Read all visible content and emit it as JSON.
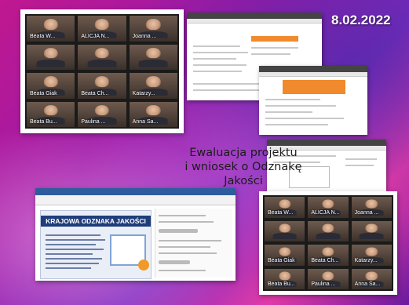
{
  "date": "8.02.2022",
  "title_line1": "Ewaluacja projektu",
  "title_line2": "i wniosek o Odznakę Jakości",
  "slide_banner": "KRAJOWA ODZNAKA JAKOŚCI",
  "meeting1": {
    "participants": [
      "Beata W...",
      "ALICJA N...",
      "Joanna ...",
      "",
      "",
      "",
      "Beata Giak",
      "Beata Ch...",
      "Katarzy...",
      "Beata Bu...",
      "Paulina ...",
      "Anna Sa..."
    ]
  },
  "meeting2": {
    "participants": [
      "Beata W...",
      "ALICJA N...",
      "Joanna ...",
      "",
      "",
      "",
      "Beata Giak",
      "Beata Ch...",
      "Katarzy...",
      "Beata Bu...",
      "Paulina ...",
      "Anna Sa..."
    ]
  },
  "colors": {
    "accent": "#f08a2c",
    "banner": "#1f3d7a"
  }
}
